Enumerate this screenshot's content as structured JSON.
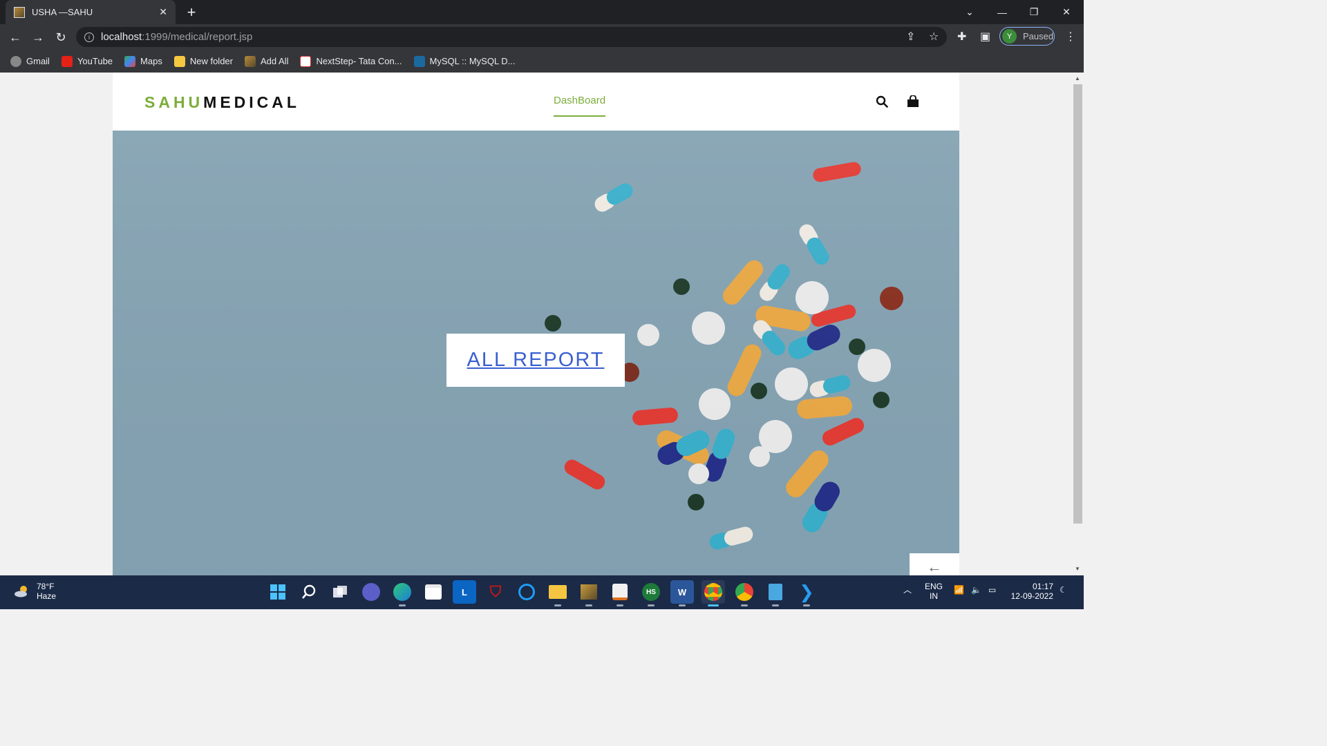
{
  "browser": {
    "tab_title": "USHA —SAHU",
    "new_tab": "+",
    "url_host": "localhost",
    "url_path": ":1999/medical/report.jsp",
    "profile_initial": "Y",
    "profile_status": "Paused",
    "bookmarks": [
      "Gmail",
      "YouTube",
      "Maps",
      "New folder",
      "Add All",
      "NextStep- Tata Con...",
      "MySQL :: MySQL D..."
    ]
  },
  "site": {
    "logo_part1": "SAHU",
    "logo_part2": "MEDICAL",
    "nav_dashboard": "DashBoard",
    "hero_link": "ALL REPORT",
    "colors": {
      "brand_green": "#7bad3a",
      "hero_bg": "#85a3b3",
      "link_blue": "#3a5fd0"
    }
  },
  "taskbar": {
    "weather_temp": "78°F",
    "weather_desc": "Haze",
    "lang1": "ENG",
    "lang2": "IN",
    "time": "01:17",
    "date": "12-09-2022"
  }
}
